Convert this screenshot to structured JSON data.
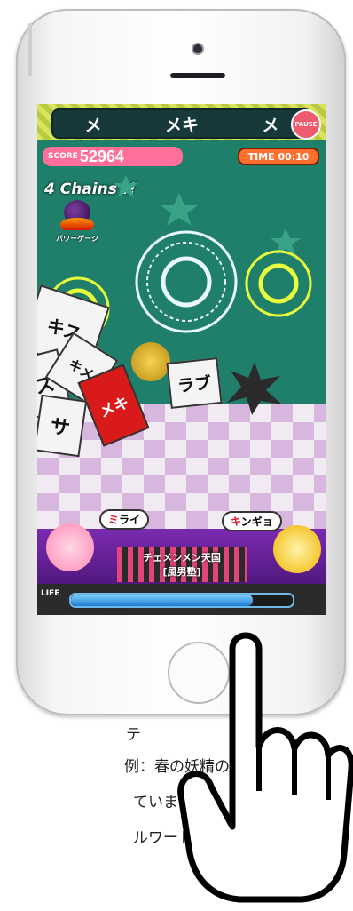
{
  "game": {
    "word_bar": [
      "メ",
      "メキ",
      "メ"
    ],
    "pause_label": "PAUSE",
    "score_label": "SCORE",
    "score_value": "52964",
    "time_label": "TIME",
    "time_value": "00:10",
    "chains_text": "4 Chains !!",
    "power_gauge_label": "パワーゲージ",
    "cube_words": [
      "キス",
      "ス",
      "キメ",
      "メキ",
      "ラブ",
      "サ"
    ],
    "bubble_left_red": "ミ",
    "bubble_left_rest": "ライ",
    "bubble_right_red": "キ",
    "bubble_right_rest": "ンギョ",
    "banner_line1": "チェメンメン天国",
    "banner_line2": "[風男塾]",
    "life_label": "LIFE",
    "life_fraction": 0.82
  },
  "caption": {
    "line1": "テ",
    "line2": "例：春の妖精の",
    "line3": "ています。）",
    "line4": "ルワード」が入"
  },
  "colors": {
    "game_bg": "#1f7f6a",
    "score_pink": "#ff6f9a",
    "time_orange": "#ff6f2e",
    "life_blue": "#1d7ed0"
  }
}
